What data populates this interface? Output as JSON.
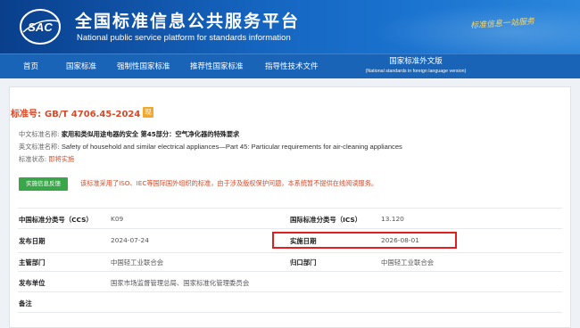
{
  "header": {
    "logo_text": "SAC",
    "title": "全国标准信息公共服务平台",
    "subtitle": "National public service platform  for standards information",
    "slogan": "标准信息一站服务"
  },
  "nav": {
    "items": [
      {
        "label": "首页"
      },
      {
        "label": "国家标准"
      },
      {
        "label": "强制性国家标准"
      },
      {
        "label": "推荐性国家标准"
      },
      {
        "label": "指导性技术文件"
      }
    ],
    "foreign": {
      "label": "国家标准外文版",
      "sub": "(National standards in foreign language version)"
    }
  },
  "standard": {
    "prefix": "标准号:",
    "number": "GB/T 4706.45-2024",
    "badge": "现",
    "cn_name_label": "中文标准名称:",
    "cn_name": "家用和类似用途电器的安全 第45部分：空气净化器的特殊要求",
    "en_name_label": "英文标准名称:",
    "en_name": "Safety of household and similar electrical appliances—Part 45: Particular requirements for air-cleaning appliances",
    "status_label": "标准状态:",
    "status": "即将实施"
  },
  "open_button": "实施信息反馈",
  "notice": "该标准采用了ISO、IEC等国际国外组织的标准，由于涉及版权保护问题，本系统暂不提供在线阅读服务。",
  "details": {
    "ccs_label": "中国标准分类号（CCS）",
    "ccs": "K09",
    "ics_label": "国际标准分类号（ICS）",
    "ics": "13.120",
    "pub_date_label": "发布日期",
    "pub_date": "2024-07-24",
    "impl_date_label": "实施日期",
    "impl_date": "2026-08-01",
    "dept_label": "主管部门",
    "dept": "中国轻工业联合会",
    "central_label": "归口部门",
    "central": "中国轻工业联合会",
    "issuer_label": "发布单位",
    "issuer": "国家市场监督管理总局、国家标准化管理委员会",
    "remark_label": "备注"
  },
  "colors": {
    "header_blue": "#1565c0",
    "nav_blue": "#1a64b8",
    "accent_red": "#d44a2a",
    "button_green": "#3aa64a",
    "highlight_red": "#e02020"
  }
}
